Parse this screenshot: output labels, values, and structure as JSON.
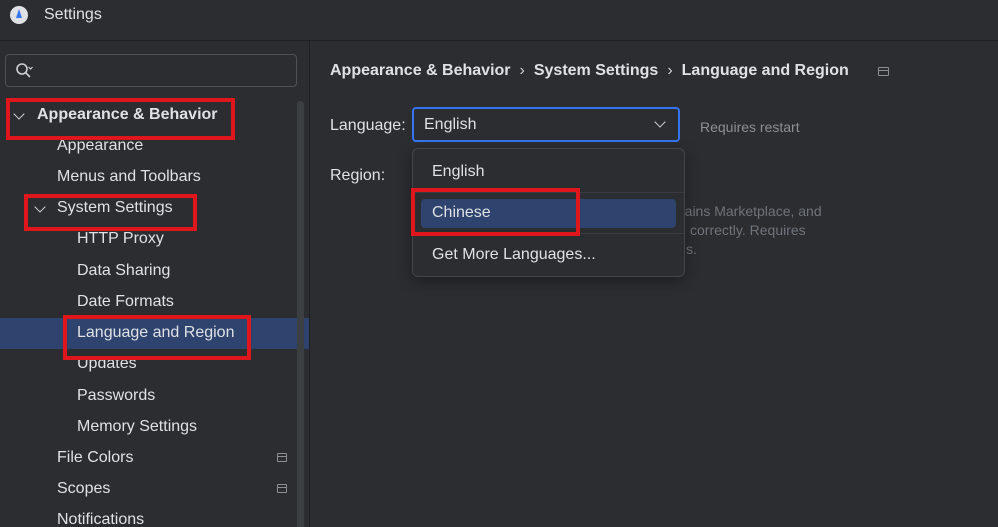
{
  "window": {
    "title": "Settings"
  },
  "search": {
    "placeholder": ""
  },
  "sidebar": {
    "items": [
      {
        "label": "Appearance & Behavior"
      },
      {
        "label": "Appearance"
      },
      {
        "label": "Menus and Toolbars"
      },
      {
        "label": "System Settings"
      },
      {
        "label": "HTTP Proxy"
      },
      {
        "label": "Data Sharing"
      },
      {
        "label": "Date Formats"
      },
      {
        "label": "Language and Region"
      },
      {
        "label": "Updates"
      },
      {
        "label": "Passwords"
      },
      {
        "label": "Memory Settings"
      },
      {
        "label": "File Colors"
      },
      {
        "label": "Scopes"
      },
      {
        "label": "Notifications"
      }
    ]
  },
  "breadcrumb": [
    "Appearance & Behavior",
    "System Settings",
    "Language and Region"
  ],
  "language": {
    "label": "Language:",
    "value": "English",
    "note": "Requires restart"
  },
  "region": {
    "label": "Region:"
  },
  "region_hint": [
    "rains Marketplace, and",
    "correctly. Requires",
    "s."
  ],
  "dropdown": {
    "options": [
      "English",
      "Chinese",
      "Get More Languages..."
    ]
  },
  "colors": {
    "accent": "#3574f0",
    "selection": "#2e436e",
    "highlight_box": "#e0161d",
    "background": "#2b2d30"
  }
}
